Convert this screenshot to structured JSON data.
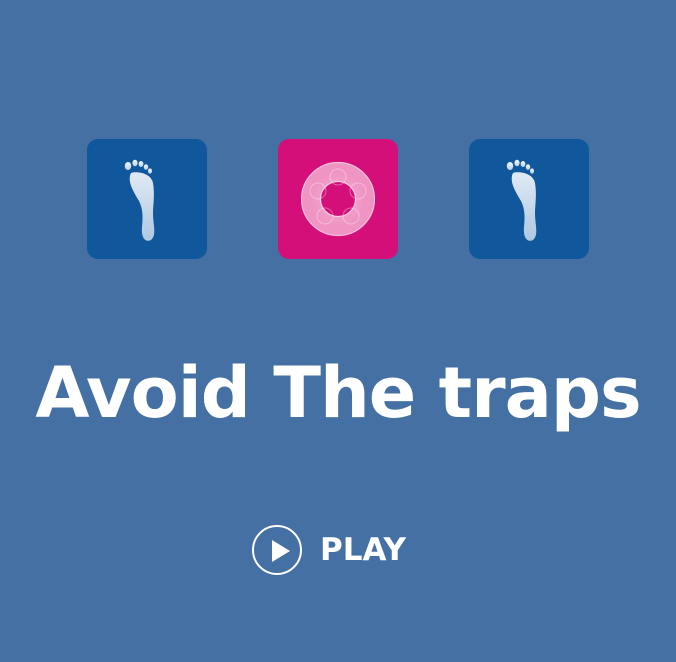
{
  "title": "Avoid The traps",
  "play_button": {
    "label": "PLAY",
    "icon": "play-icon"
  },
  "tiles": [
    {
      "kind": "footprint",
      "icon": "footprint-icon",
      "color": "#10579c"
    },
    {
      "kind": "trap",
      "icon": "ring-trap-icon",
      "color": "#d40f79"
    },
    {
      "kind": "footprint",
      "icon": "footprint-icon",
      "color": "#10579c"
    }
  ],
  "colors": {
    "background": "#4470a3",
    "tile_blue": "#10579c",
    "tile_pink": "#d40f79",
    "text": "#ffffff"
  }
}
